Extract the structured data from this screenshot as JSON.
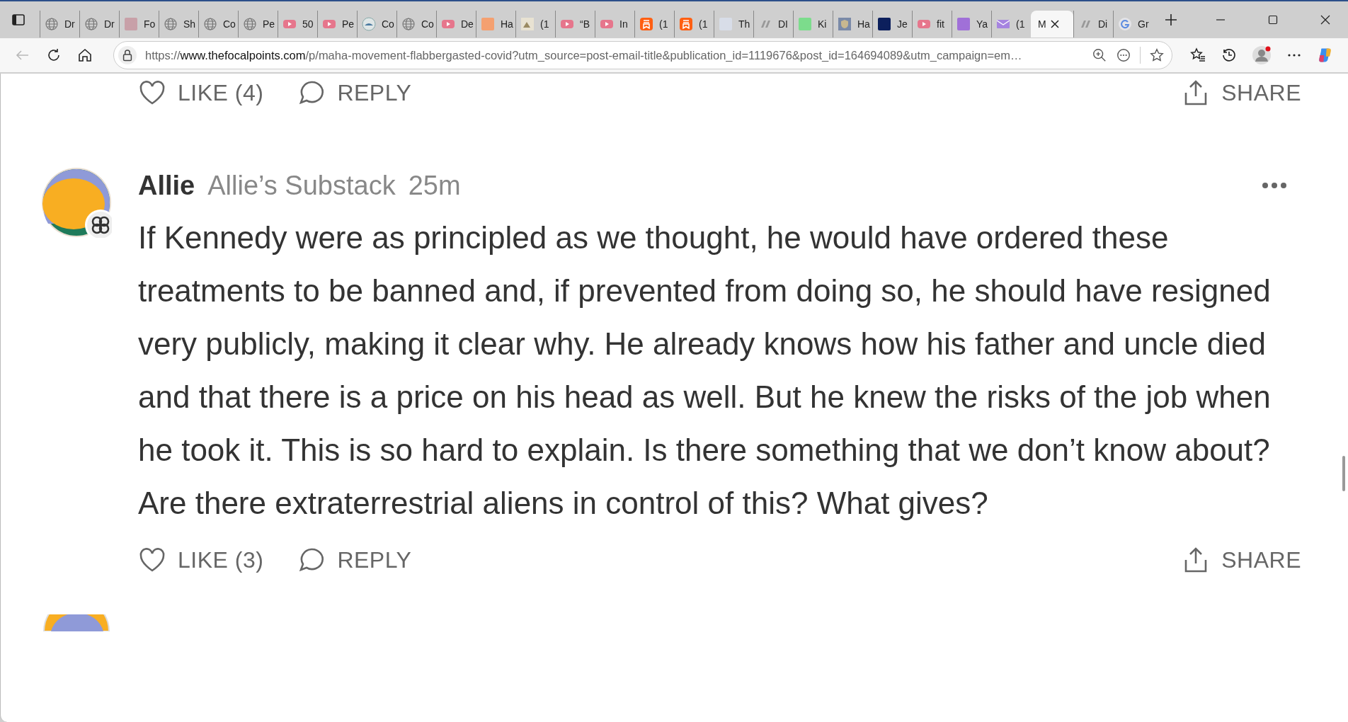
{
  "tabs": [
    {
      "kind": "globe",
      "title": "Dr",
      "selected": false
    },
    {
      "kind": "globe",
      "title": "Dr",
      "selected": false
    },
    {
      "kind": "news",
      "title": "Fo",
      "selected": false
    },
    {
      "kind": "globe",
      "title": "Sh",
      "selected": false
    },
    {
      "kind": "globe",
      "title": "Co",
      "selected": false
    },
    {
      "kind": "globe",
      "title": "Pe",
      "selected": false
    },
    {
      "kind": "video",
      "title": "50",
      "selected": false
    },
    {
      "kind": "video",
      "title": "Pe",
      "selected": false
    },
    {
      "kind": "seal",
      "title": "Co",
      "selected": false
    },
    {
      "kind": "globe",
      "title": "Co",
      "selected": false
    },
    {
      "kind": "video",
      "title": "De",
      "selected": false
    },
    {
      "kind": "orange",
      "title": "Ha",
      "selected": false
    },
    {
      "kind": "image",
      "title": "(1",
      "selected": false
    },
    {
      "kind": "video",
      "title": "“B",
      "selected": false
    },
    {
      "kind": "video",
      "title": "In",
      "selected": false
    },
    {
      "kind": "bookmark",
      "title": "(1",
      "selected": false
    },
    {
      "kind": "bookmark",
      "title": "(1",
      "selected": false
    },
    {
      "kind": "pale",
      "title": "Th",
      "selected": false
    },
    {
      "kind": "slash",
      "title": "DI",
      "selected": false
    },
    {
      "kind": "green",
      "title": "Ki",
      "selected": false
    },
    {
      "kind": "shield",
      "title": "Ha",
      "selected": false
    },
    {
      "kind": "navy",
      "title": "Je",
      "selected": false
    },
    {
      "kind": "video",
      "title": "fit",
      "selected": false
    },
    {
      "kind": "purple",
      "title": "Ya",
      "selected": false
    },
    {
      "kind": "mail",
      "title": "(1",
      "selected": false
    },
    {
      "kind": "plain",
      "title": "M",
      "selected": true
    },
    {
      "kind": "slash",
      "title": "Di",
      "selected": false
    },
    {
      "kind": "gcircle",
      "title": "Gr",
      "selected": false
    }
  ],
  "address": {
    "scheme": "https://",
    "host": "www.thefocalpoints.com",
    "path": "/p/maha-movement-flabbergasted-covid?utm_source=post-email-title&publication_id=1119676&post_id=164694089&utm_campaign=em…"
  },
  "top_actions": {
    "like": "LIKE (4)",
    "reply": "REPLY",
    "share": "SHARE"
  },
  "comment": {
    "author": "Allie",
    "publication": "Allie’s Substack",
    "time": "25m",
    "body": "If Kennedy were as principled as we thought, he would have ordered these treatments to be banned and, if prevented from doing so, he should have resigned very publicly, making it clear why. He already knows how his father and uncle died and that there is a price on his head as well. But he knew the risks of the job when he took it. This is so hard to explain. Is there something that we don’t know about? Are there extraterrestrial aliens in control of this? What gives?",
    "actions": {
      "like": "LIKE (3)",
      "reply": "REPLY",
      "share": "SHARE"
    }
  }
}
